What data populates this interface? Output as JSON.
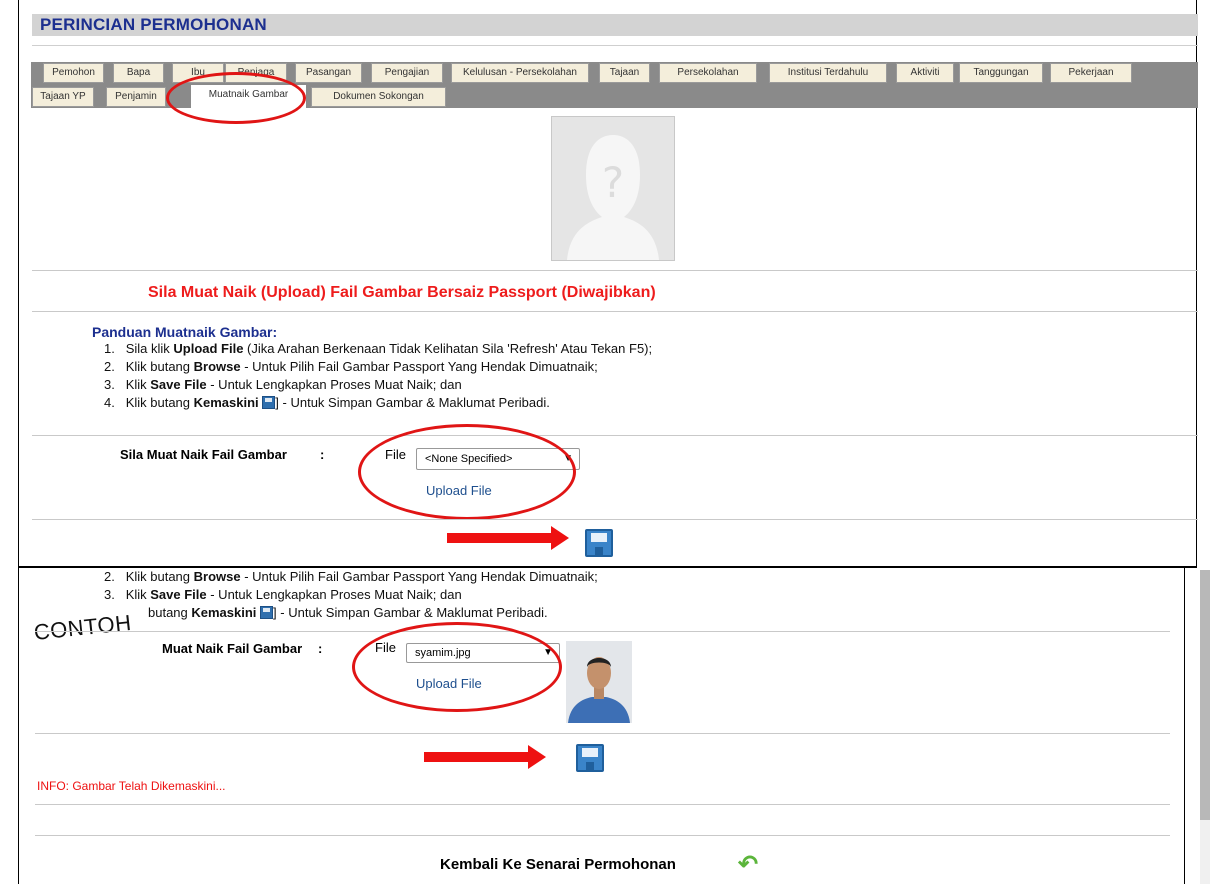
{
  "title": "PERINCIAN PERMOHONAN",
  "tabs_row1": [
    "Pemohon",
    "Bapa",
    "Ibu",
    "Penjaga",
    "Pasangan",
    "Pengajian",
    "Kelulusan - Persekolahan",
    "Tajaan",
    "Persekolahan",
    "Institusi Terdahulu",
    "Aktiviti",
    "Tanggungan",
    "Pekerjaan"
  ],
  "tabs_row2": [
    "Tajaan YP",
    "Penjamin",
    "Muatnaik Gambar",
    "Dokumen Sokongan"
  ],
  "required_msg": "Sila Muat Naik (Upload) Fail Gambar Bersaiz Passport (Diwajibkan)",
  "guide": {
    "heading": "Panduan Muatnaik Gambar:",
    "step1_a": "Sila klik ",
    "step1_b": "Upload File",
    "step1_c": " (Jika Arahan Berkenaan Tidak Kelihatan Sila 'Refresh' Atau Tekan F5);",
    "step2_a": "Klik butang ",
    "step2_b": "Browse",
    "step2_c": " - Untuk Pilih Fail Gambar Passport Yang Hendak Dimuatnaik;",
    "step3_a": "Klik ",
    "step3_b": "Save File",
    "step3_c": " - Untuk Lengkapkan Proses Muat Naik; dan",
    "step4_a": "Klik butang ",
    "step4_b": "Kemaskini",
    "step4_c": "] - Untuk Simpan Gambar & Maklumat Peribadi."
  },
  "n1": "1.",
  "n2": "2.",
  "n3": "3.",
  "n4": "4.",
  "upload": {
    "label": "Sila Muat Naik Fail Gambar",
    "colon": ":",
    "file_label": "File",
    "select_value": "<None Specified>",
    "link": "Upload File"
  },
  "example": {
    "contoh": "CONTOH",
    "step2_a": "Klik butang ",
    "step2_b": "Browse",
    "step2_c": " - Untuk Pilih Fail Gambar Passport Yang Hendak Dimuatnaik;",
    "step3_a": "Klik ",
    "step3_b": "Save File",
    "step3_c": " - Untuk Lengkapkan Proses Muat Naik; dan",
    "step4_a": "butang ",
    "step4_b": "Kemaskini",
    "step4_c": "] - Untuk Simpan Gambar & Maklumat Peribadi.",
    "label": "Muat Naik Fail Gambar",
    "colon": ":",
    "file_label": "File",
    "select_value": "syamim.jpg",
    "link": "Upload File",
    "info": "INFO: Gambar Telah Dikemaskini...",
    "back": "Kembali Ke Senarai Permohonan"
  },
  "colors": {
    "title": "#1c2f8f",
    "required": "#ee1c1c",
    "annotation": "#e01515"
  }
}
